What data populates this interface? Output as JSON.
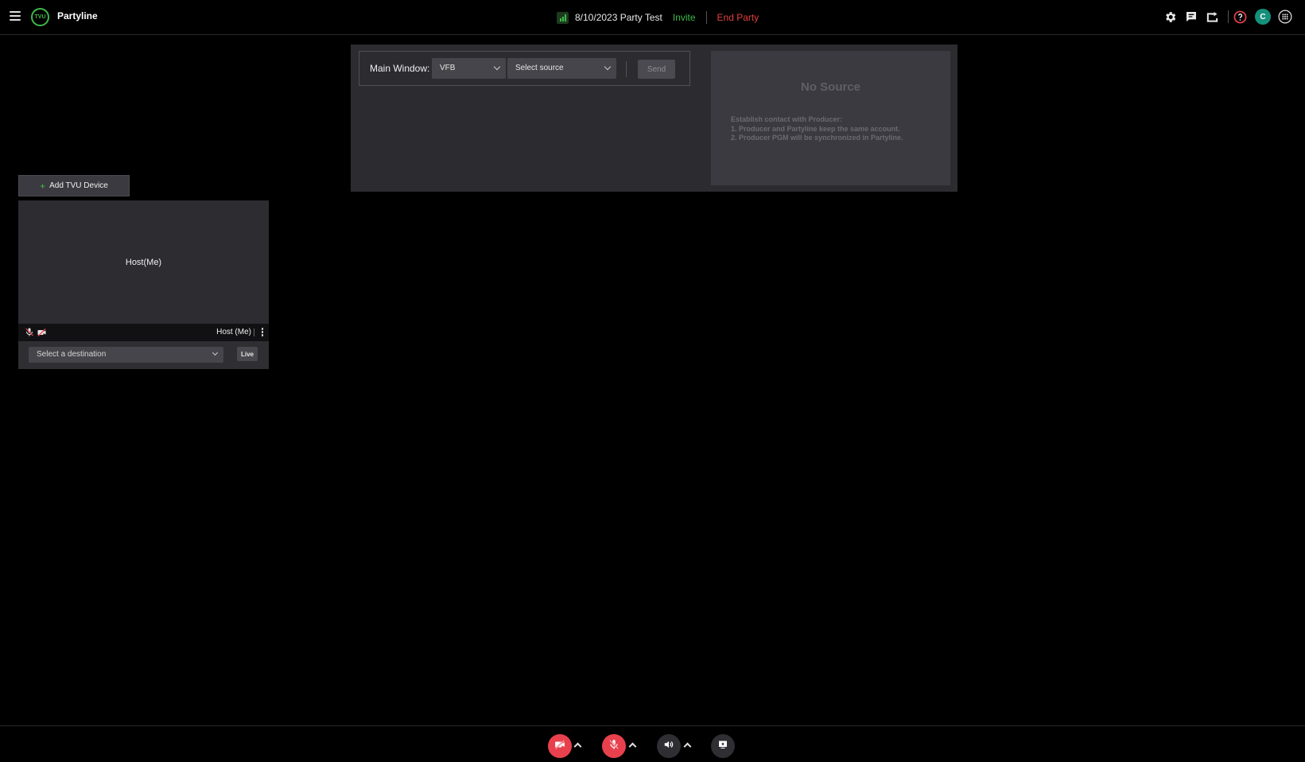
{
  "app": {
    "title": "Partyline",
    "logo_text": "TVU"
  },
  "header": {
    "party_name": "8/10/2023 Party Test",
    "invite_label": "Invite",
    "end_party_label": "End Party",
    "avatar_initial": "C"
  },
  "main_window": {
    "label": "Main Window:",
    "platform_select": "VFB",
    "source_placeholder": "Select source",
    "send_label": "Send",
    "preview": {
      "title": "No Source",
      "instructions": [
        "Establish contact with Producer:",
        "1. Producer and Partyline keep the same account.",
        "2. Producer PGM will be synchronized in Partyline."
      ]
    }
  },
  "devices": {
    "add_button_label": "Add TVU Device",
    "cards": [
      {
        "video_label": "Host(Me)",
        "name": "Host (Me)",
        "destination_placeholder": "Select a destination",
        "live_label": "Live"
      }
    ]
  },
  "colors": {
    "accent_green": "#3fb94a",
    "danger_red": "#e0413c",
    "control_red": "#e8414d",
    "avatar_teal": "#15907b"
  },
  "icons": {
    "top_right": [
      "gear-icon",
      "chat-icon",
      "share-screen-icon",
      "help-icon",
      "avatar",
      "apps-grid-icon"
    ],
    "bottom": [
      "camera-off-icon",
      "mic-off-icon",
      "speaker-icon",
      "screen-share-icon"
    ]
  }
}
